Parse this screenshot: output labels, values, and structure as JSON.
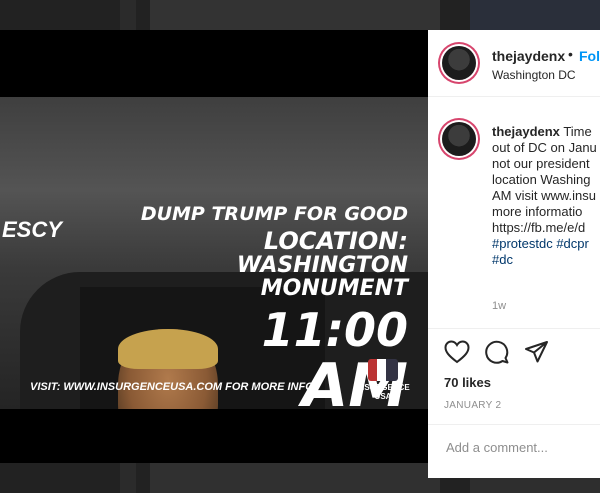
{
  "post": {
    "username": "thejaydenx",
    "separator": "•",
    "follow_label": "Foll",
    "location": "Washington DC",
    "caption_lines": [
      "Time",
      "out of DC on Janu",
      "not our president",
      "location Washing",
      "AM visit www.insu",
      "more informatio",
      "https://fb.me/e/d"
    ],
    "hashtag_line1": "#protestdc #dcpr",
    "hashtag_line2": "#dc",
    "time_ago": "1w",
    "likes": "70 likes",
    "date": "JANUARY 2",
    "comment_placeholder": "Add a comment..."
  },
  "media": {
    "line1": "DUMP TRUMP FOR GOOD",
    "line2": "LOCATION:",
    "line3": "WASHINGTON",
    "line4": "MONUMENT",
    "line5": "11:00",
    "line6": "AM",
    "left_text": "ESCY",
    "footer": "VISIT: WWW.INSURGENCEUSA.COM FOR MORE INFO",
    "logo_text": "INSURGENCE USA"
  },
  "icons": {
    "like": "heart-icon",
    "comment": "comment-icon",
    "share": "share-icon"
  },
  "colors": {
    "follow": "#0095f6",
    "story_ring": "#d7456d",
    "hashtag": "#00376b"
  }
}
